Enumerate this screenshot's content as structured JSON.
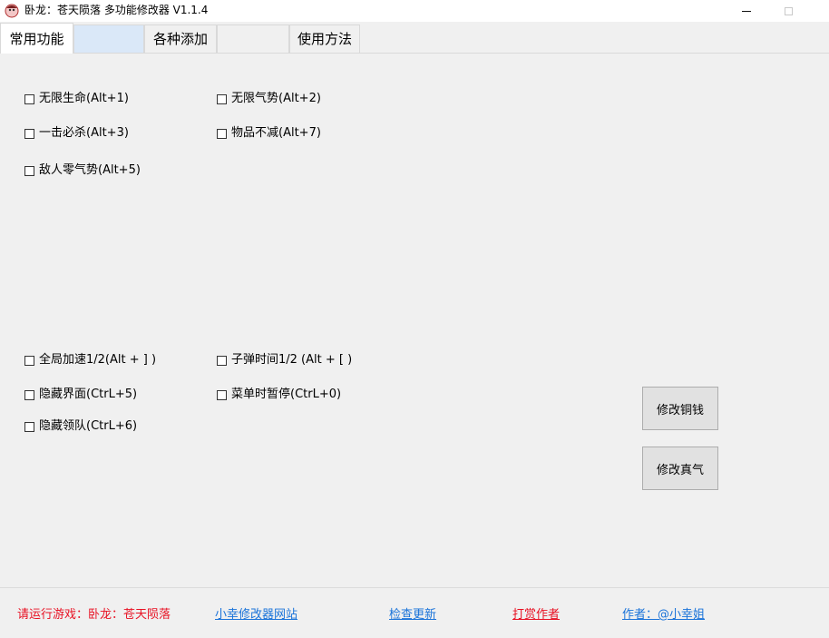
{
  "window": {
    "title": "卧龙：苍天陨落  多功能修改器  V1.1.4"
  },
  "tabs": [
    {
      "label": "常用功能"
    },
    {
      "label": ""
    },
    {
      "label": "各种添加"
    },
    {
      "label": ""
    },
    {
      "label": "使用方法"
    }
  ],
  "options": {
    "infinite_hp": "无限生命(Alt+1)",
    "infinite_morale": "无限气势(Alt+2)",
    "one_hit_kill": "一击必杀(Alt+3)",
    "items_no_decrease": "物品不减(Alt+7)",
    "enemy_zero_morale": "敌人零气势(Alt+5)",
    "global_speed": "全局加速1/2(Alt + ] )",
    "bullet_time": "子弹时间1/2 (Alt + [ )",
    "hide_ui": "隐藏界面(CtrL+5)",
    "menu_pause": "菜单时暂停(CtrL+0)",
    "hide_team": "隐藏领队(CtrL+6)"
  },
  "buttons": {
    "modify_copper": "修改铜钱",
    "modify_qi": "修改真气"
  },
  "footer": {
    "run_game": "请运行游戏：卧龙：苍天陨落",
    "site": "小幸修改器网站",
    "update": "检查更新",
    "donate": "打赏作者",
    "author": "作者：@小幸姐"
  },
  "colors": {
    "accent_red": "#e81123",
    "link_blue": "#1a73d9",
    "tab_blank_blue": "#dae8f8"
  }
}
